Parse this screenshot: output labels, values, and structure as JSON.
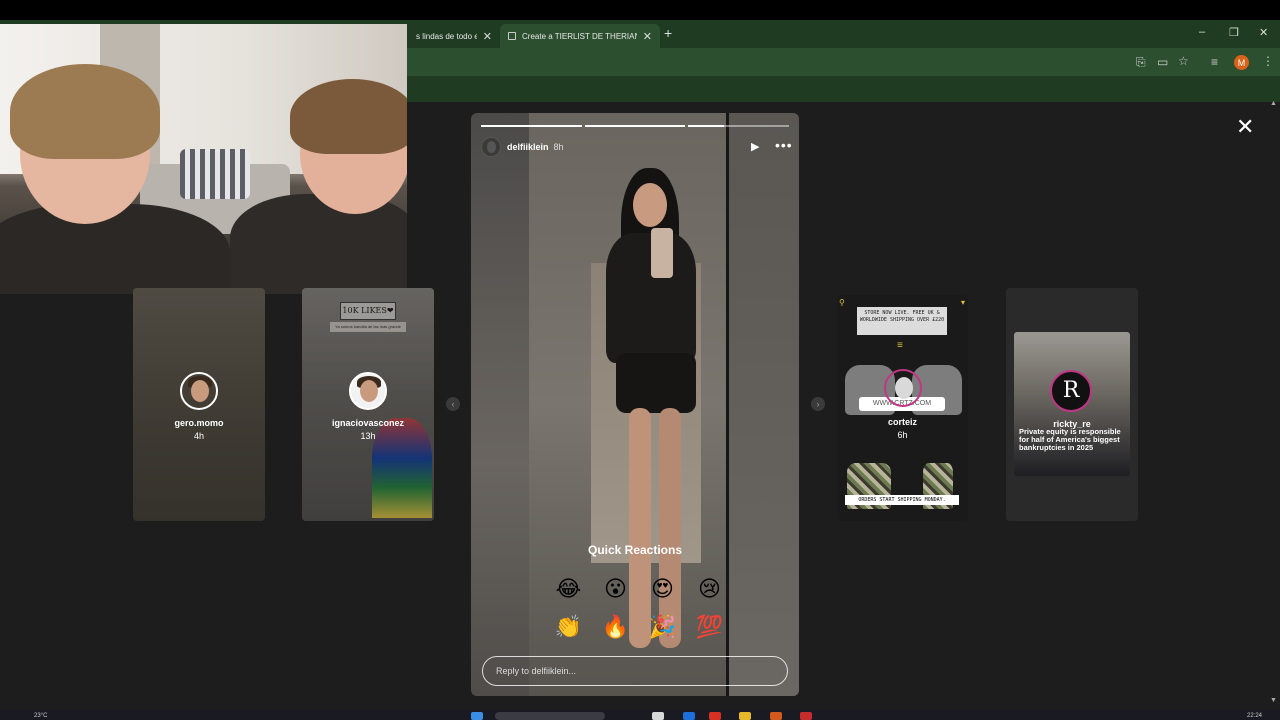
{
  "browser": {
    "tabs": [
      {
        "title": "s lindas de todo el "
      },
      {
        "title": "Create a TIERLIST DE THERIANS"
      }
    ],
    "new_tab_icon": "plus-icon",
    "window_controls": [
      "minimize-icon",
      "maximize-icon",
      "close-icon"
    ],
    "toolbar_icons": [
      "translate-icon",
      "cast-icon",
      "star-icon",
      "media-icon"
    ],
    "profile_initial": "M",
    "accent": "#1f3b22"
  },
  "stories": {
    "left": [
      {
        "username": "gero.momo",
        "age": "4h"
      },
      {
        "username": "ignaciovasconez",
        "age": "13h",
        "sign": "10K LIKES❤",
        "sign_sub": "Ya somos bandita de las mas grande"
      }
    ],
    "right": [
      {
        "username": "corteiz",
        "age": "6h",
        "banner": "STORE NOW LIVE. FREE UK & WORLDWIDE SHIPPING OVER £220",
        "url": "WWW.CRTZ.COM",
        "footer": "ORDERS START SHIPPING MONDAY."
      },
      {
        "username": "rickty_re",
        "caption": "Private equity is responsible for half of America's biggest bankruptcies in 2025"
      }
    ]
  },
  "main_story": {
    "username": "delfiiklein",
    "age": "8h",
    "progress": [
      1.0,
      1.0,
      0.35
    ],
    "quick_reactions_title": "Quick Reactions",
    "reactions": [
      "😂",
      "😮",
      "😍",
      "😢",
      "👏",
      "🔥",
      "🎉",
      "💯"
    ],
    "reply_placeholder": "Reply to delfiiklein..."
  },
  "taskbar": {
    "weather": "23°C",
    "clock": "22:24"
  }
}
